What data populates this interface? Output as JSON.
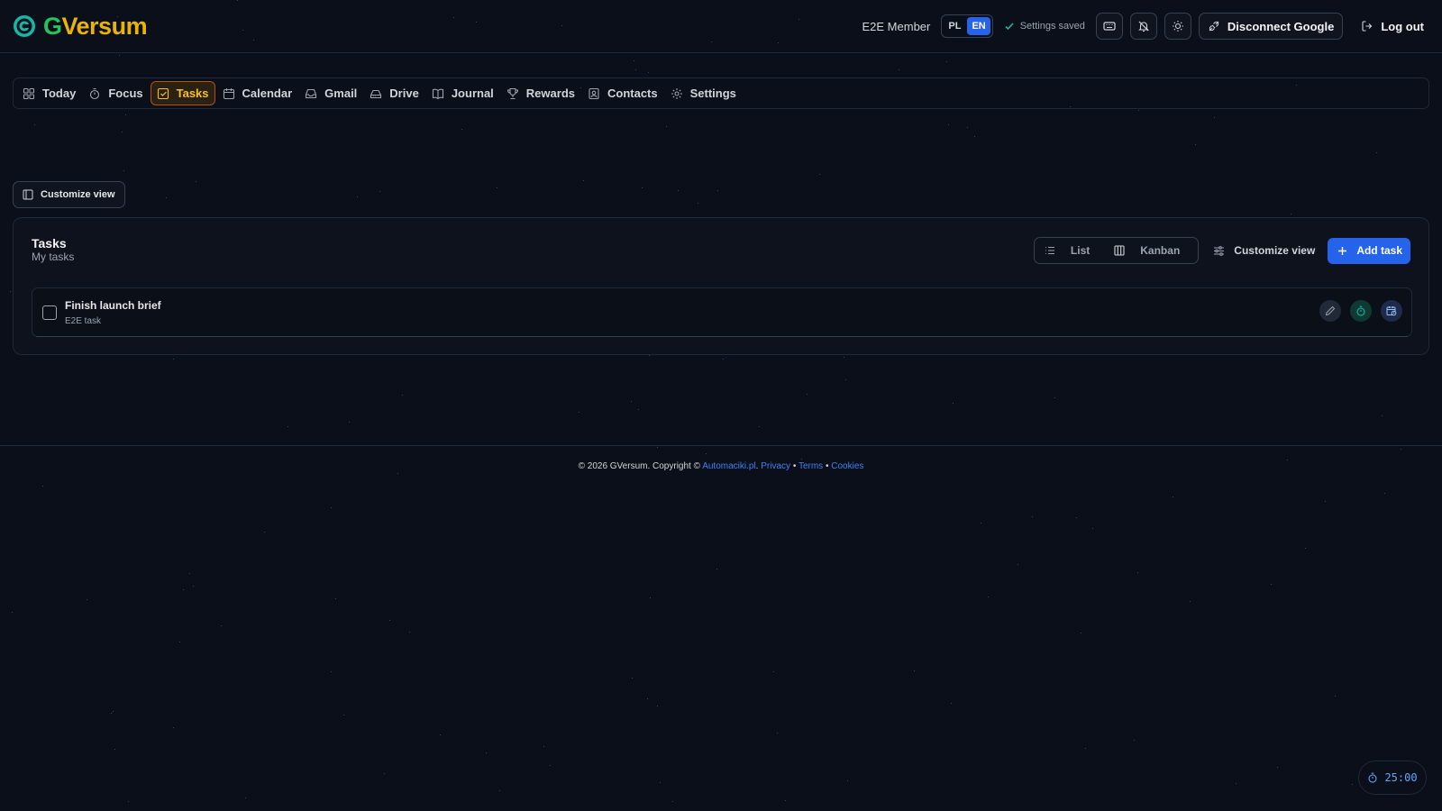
{
  "header": {
    "logo_g": "G",
    "logo_rest": "Versum",
    "user": "E2E Member",
    "languages": [
      "PL",
      "EN"
    ],
    "active_language": "EN",
    "status": "Settings saved",
    "disconnect_label": "Disconnect Google",
    "logout_label": "Log out"
  },
  "nav": {
    "items": [
      {
        "label": "Today",
        "icon": "grid-icon"
      },
      {
        "label": "Focus",
        "icon": "timer-icon"
      },
      {
        "label": "Tasks",
        "icon": "check-square-icon",
        "active": true
      },
      {
        "label": "Calendar",
        "icon": "calendar-icon"
      },
      {
        "label": "Gmail",
        "icon": "inbox-icon"
      },
      {
        "label": "Drive",
        "icon": "drive-icon"
      },
      {
        "label": "Journal",
        "icon": "book-icon"
      },
      {
        "label": "Rewards",
        "icon": "trophy-icon"
      },
      {
        "label": "Contacts",
        "icon": "contacts-icon"
      },
      {
        "label": "Settings",
        "icon": "gear-icon"
      }
    ]
  },
  "customize_top": "Customize view",
  "tasks": {
    "title": "Tasks",
    "subtitle": "My tasks",
    "view_list": "List",
    "view_kanban": "Kanban",
    "customize": "Customize view",
    "add": "Add task",
    "items": [
      {
        "title": "Finish launch brief",
        "tag": "E2E task"
      }
    ]
  },
  "footer": {
    "copyright": "© 2026 GVersum. Copyright ©",
    "company": "Automaciki.pl",
    "dot": ".",
    "privacy": "Privacy",
    "terms": "Terms",
    "cookies": "Cookies",
    "sep": "•"
  },
  "timer": "25:00",
  "colors": {
    "accent": "#2563eb",
    "active_nav": "#fbbf24",
    "logo_green": "#22c55e",
    "logo_yellow": "#eab308"
  }
}
